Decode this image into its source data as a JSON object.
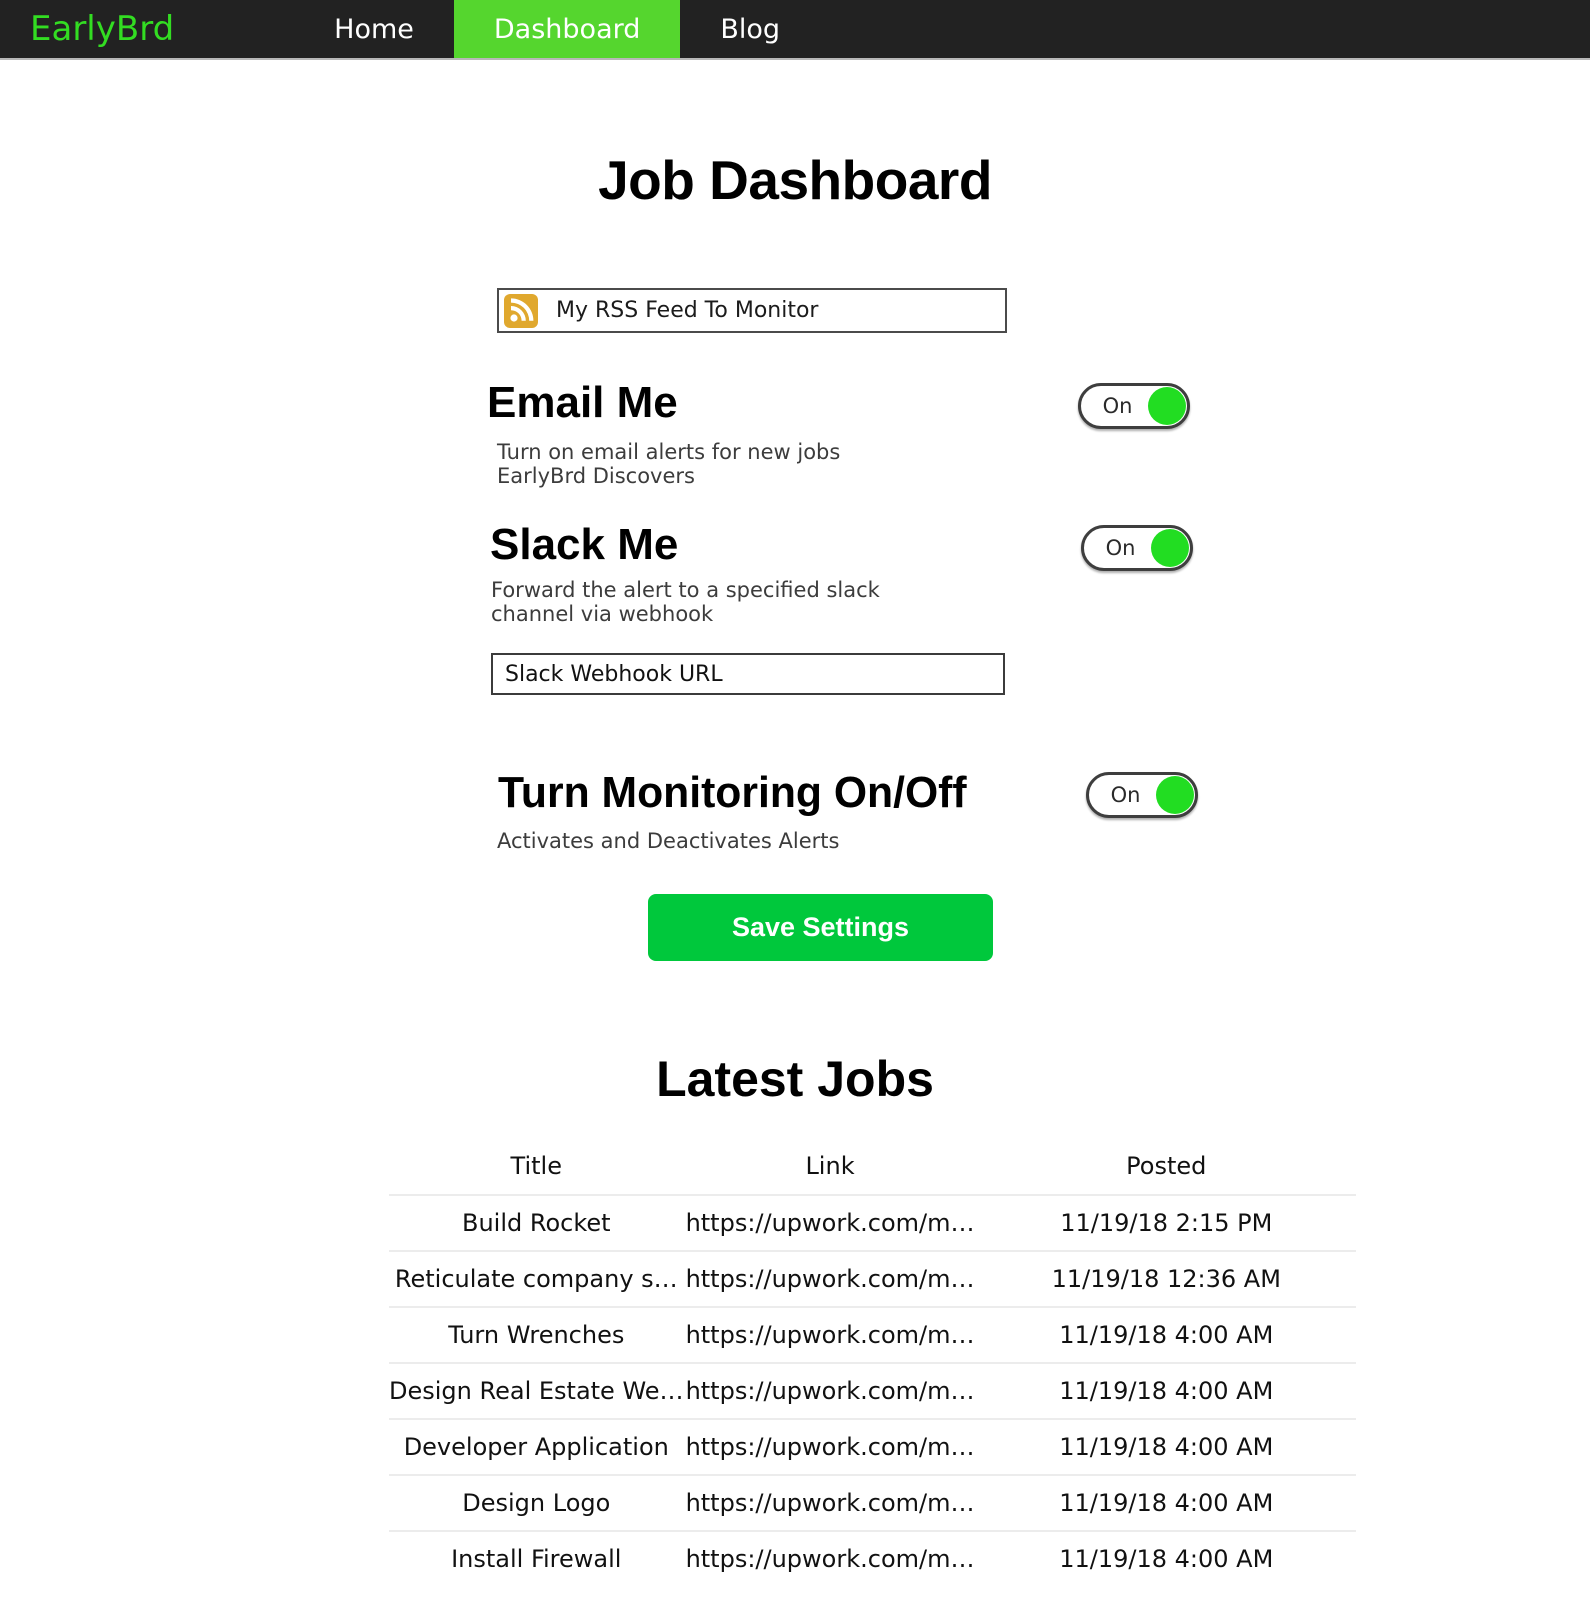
{
  "navbar": {
    "brand": "EarlyBrd",
    "items": [
      {
        "label": "Home",
        "active": false
      },
      {
        "label": "Dashboard",
        "active": true
      },
      {
        "label": "Blog",
        "active": false
      }
    ],
    "background_color": "#222222",
    "active_color": "#55d62e",
    "brand_color": "#33dd22"
  },
  "page": {
    "title": "Job Dashboard"
  },
  "feed": {
    "icon": "rss-icon",
    "value": "My RSS Feed To Monitor",
    "placeholder": "My RSS Feed To Monitor"
  },
  "settings": {
    "email": {
      "title": "Email Me",
      "description": "Turn on email alerts for new jobs EarlyBrd Discovers",
      "toggle_label": "On",
      "toggle_state": "on"
    },
    "slack": {
      "title": "Slack Me",
      "description": "Forward the alert to a specified slack channel via webhook",
      "toggle_label": "On",
      "toggle_state": "on",
      "webhook_value": "Slack Webhook URL",
      "webhook_placeholder": "Slack Webhook URL"
    },
    "monitoring": {
      "title": "Turn Monitoring On/Off",
      "description": "Activates and Deactivates Alerts",
      "toggle_label": "On",
      "toggle_state": "on"
    },
    "save_label": "Save Settings",
    "save_color": "#00c83c"
  },
  "jobs": {
    "heading": "Latest Jobs",
    "columns": [
      "Title",
      "Link",
      "Posted"
    ],
    "rows": [
      {
        "title": "Build Rocket",
        "link": "https://upwork.com/m…",
        "posted": "11/19/18 2:15 PM"
      },
      {
        "title": "Reticulate company s…",
        "link": "https://upwork.com/m…",
        "posted": "11/19/18 12:36 AM"
      },
      {
        "title": "Turn Wrenches",
        "link": "https://upwork.com/m…",
        "posted": "11/19/18 4:00 AM"
      },
      {
        "title": "Design Real Estate We…",
        "link": "https://upwork.com/m…",
        "posted": "11/19/18 4:00 AM"
      },
      {
        "title": "Developer Application",
        "link": "https://upwork.com/m…",
        "posted": "11/19/18 4:00 AM"
      },
      {
        "title": "Design Logo",
        "link": "https://upwork.com/m…",
        "posted": "11/19/18 4:00 AM"
      },
      {
        "title": "Install Firewall",
        "link": "https://upwork.com/m…",
        "posted": "11/19/18 4:00 AM"
      }
    ]
  }
}
